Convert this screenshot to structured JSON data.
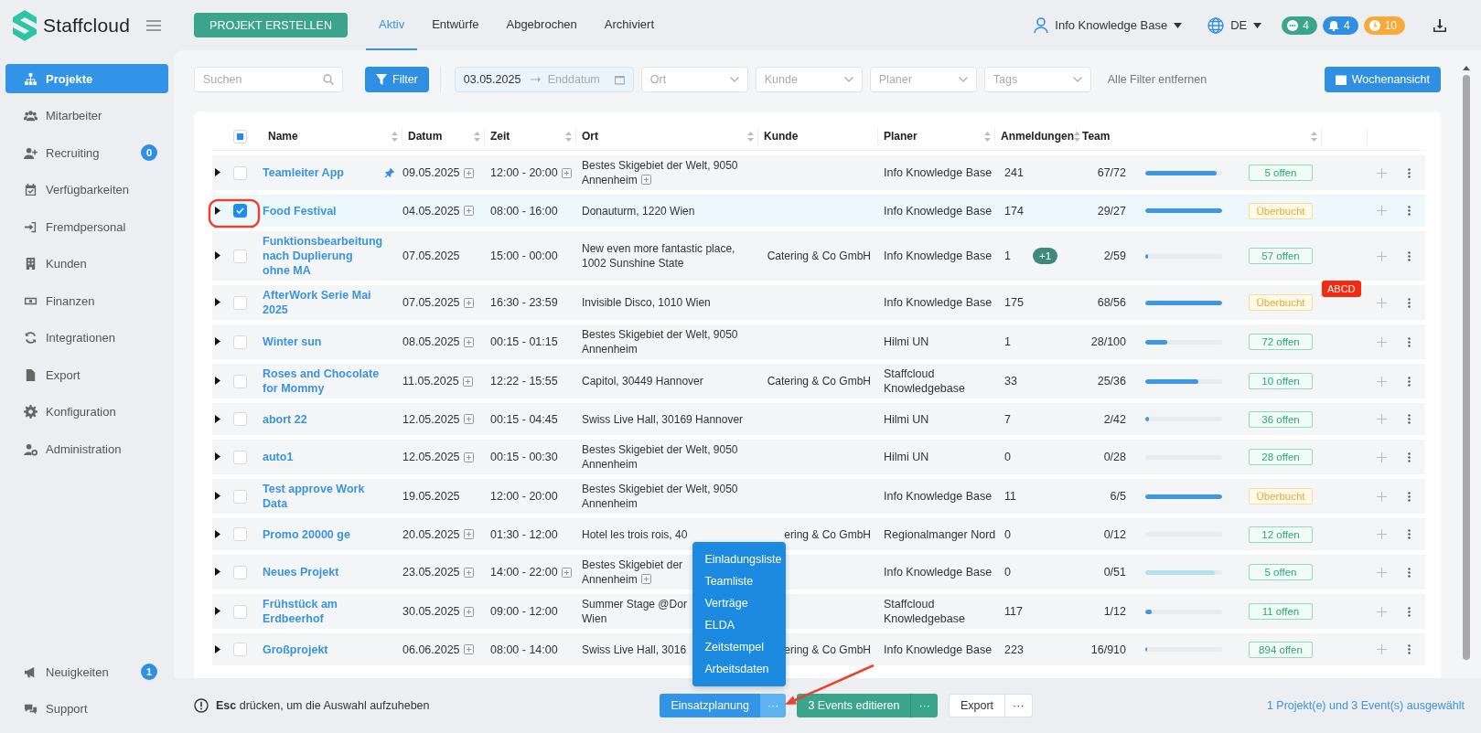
{
  "sidebar": {
    "brand": "Staffcloud",
    "items": [
      {
        "label": "Projekte",
        "selected": true
      },
      {
        "label": "Mitarbeiter",
        "selected": false
      },
      {
        "label": "Recruiting",
        "selected": false,
        "badge": "0"
      },
      {
        "label": "Verfügbarkeiten",
        "selected": false
      },
      {
        "label": "Fremdpersonal",
        "selected": false
      },
      {
        "label": "Kunden",
        "selected": false
      },
      {
        "label": "Finanzen",
        "selected": false
      },
      {
        "label": "Integrationen",
        "selected": false
      },
      {
        "label": "Export",
        "selected": false
      },
      {
        "label": "Konfiguration",
        "selected": false
      },
      {
        "label": "Administration",
        "selected": false
      }
    ],
    "footer_items": [
      {
        "label": "Neuigkeiten",
        "selected": false,
        "badge": "1"
      },
      {
        "label": "Support",
        "selected": false
      }
    ]
  },
  "topbar": {
    "create_button": "PROJEKT ERSTELLEN",
    "tabs": [
      {
        "label": "Aktiv",
        "selected": true
      },
      {
        "label": "Entwürfe",
        "selected": false
      },
      {
        "label": "Abgebrochen",
        "selected": false
      },
      {
        "label": "Archiviert",
        "selected": false
      }
    ],
    "user": "Info Knowledge Base",
    "language": "DE",
    "counters": [
      {
        "value": "4",
        "color": "#3aa58a"
      },
      {
        "value": "4",
        "color": "#2f8fe2"
      },
      {
        "value": "10",
        "color": "#f8a93a"
      }
    ]
  },
  "filters": {
    "search": {
      "placeholder": "Suchen"
    },
    "filter_button": "Filter",
    "date_range": {
      "start": "03.05.2025",
      "end_placeholder": "Enddatum"
    },
    "selects": [
      {
        "placeholder": "Ort"
      },
      {
        "placeholder": "Kunde"
      },
      {
        "placeholder": "Planer"
      },
      {
        "placeholder": "Tags"
      }
    ],
    "clear_link": "Alle Filter entfernen",
    "week_button": "Wochenansicht"
  },
  "table": {
    "select_all": {
      "partial": true
    },
    "columns": [
      "Name",
      "Datum",
      "Zeit",
      "Ort",
      "Kunde",
      "Planer",
      "Anmeldungen",
      "Team"
    ],
    "rows": [
      {
        "name": "Teamleiter App",
        "pinned": true,
        "date": "09.05.2025",
        "date_more": true,
        "time": "12:00 - 20:00",
        "time_more": true,
        "place": "Bestes Skigebiet der Welt, 9050\nAnnenheim",
        "place_more": true,
        "planner": "Info Knowledge Base",
        "registrations": "241",
        "team": "67/72",
        "level": 0.93,
        "status": {
          "label": "5 offen",
          "kind": "open"
        },
        "selected": false
      },
      {
        "name": "Food Festival",
        "pinned": false,
        "date": "04.05.2025",
        "date_more": true,
        "time": "08:00 - 16:00",
        "time_more": false,
        "place": "Donauturm, 1220 Wien",
        "place_more": false,
        "planner": "Info Knowledge Base",
        "registrations": "174",
        "team": "29/27",
        "level": 1,
        "status": {
          "label": "Überbucht",
          "kind": "overbooked"
        },
        "selected": true
      },
      {
        "name": "Funktionsbearbeitung\nnach Duplierung\nohne MA",
        "pinned": false,
        "date": "07.05.2025",
        "date_more": false,
        "time": "15:00 - 00:00",
        "time_more": false,
        "place": "New even more fantastic place,\n1002 Sunshine State",
        "place_more": false,
        "customer": "Catering & Co GmbH",
        "planner": "Info Knowledge Base",
        "registrations": "1",
        "registrations_extra": "+1",
        "team": "2/59",
        "level": 0.03,
        "status": {
          "label": "57 offen",
          "kind": "open"
        },
        "selected": false
      },
      {
        "name": "AfterWork Serie Mai\n2025",
        "pinned": false,
        "date": "07.05.2025",
        "date_more": true,
        "time": "16:30 - 23:59",
        "time_more": false,
        "place": "Invisible Disco, 1010 Wien",
        "place_more": false,
        "planner": "Info Knowledge Base",
        "registrations": "175",
        "team": "68/56",
        "level": 1,
        "status": {
          "label": "Überbucht",
          "kind": "overbooked"
        },
        "tag": "ABCD",
        "selected": false
      },
      {
        "name": "Winter sun",
        "pinned": false,
        "date": "08.05.2025",
        "date_more": true,
        "time": "00:15 - 01:15",
        "time_more": false,
        "place": "Bestes Skigebiet der Welt, 9050\nAnnenheim",
        "place_more": false,
        "planner": "Hilmi UN",
        "registrations": "1",
        "team": "28/100",
        "level": 0.28,
        "status": {
          "label": "72 offen",
          "kind": "open"
        },
        "selected": false
      },
      {
        "name": "Roses and Chocolate\nfor Mommy",
        "pinned": false,
        "date": "11.05.2025",
        "date_more": true,
        "time": "12:22 - 15:55",
        "time_more": false,
        "place": "Capitol, 30449 Hannover",
        "place_more": false,
        "customer": "Catering & Co GmbH",
        "planner": "Staffcloud\nKnowledgebase",
        "registrations": "33",
        "team": "25/36",
        "level": 0.69,
        "status": {
          "label": "10 offen",
          "kind": "open"
        },
        "selected": false
      },
      {
        "name": "abort 22",
        "pinned": false,
        "date": "12.05.2025",
        "date_more": true,
        "time": "00:15 - 04:45",
        "time_more": false,
        "place": "Swiss Live Hall, 30169 Hannover",
        "place_more": false,
        "planner": "Hilmi UN",
        "registrations": "7",
        "team": "2/42",
        "level": 0.05,
        "status": {
          "label": "36 offen",
          "kind": "open"
        },
        "selected": false
      },
      {
        "name": "auto1",
        "pinned": false,
        "date": "12.05.2025",
        "date_more": true,
        "time": "00:15 - 00:30",
        "time_more": false,
        "place": "Bestes Skigebiet der Welt, 9050\nAnnenheim",
        "place_more": false,
        "planner": "Hilmi UN",
        "registrations": "0",
        "team": "0/28",
        "level": 0,
        "status": {
          "label": "28 offen",
          "kind": "open"
        },
        "selected": false
      },
      {
        "name": "Test approve Work\nData",
        "pinned": false,
        "date": "19.05.2025",
        "date_more": false,
        "time": "12:00 - 20:00",
        "time_more": false,
        "place": "Bestes Skigebiet der Welt, 9050\nAnnenheim",
        "place_more": false,
        "planner": "Info Knowledge Base",
        "registrations": "11",
        "team": "6/5",
        "level": 1,
        "status": {
          "label": "Überbucht",
          "kind": "overbooked"
        },
        "selected": false
      },
      {
        "name": "Promo 20000 ge",
        "pinned": false,
        "date": "20.05.2025",
        "date_more": true,
        "time": "01:30 - 12:00",
        "time_more": false,
        "place": "Hotel les trois rois, 40",
        "place_more": false,
        "customer": "ering & Co GmbH",
        "planner": "Regionalmanger Nord",
        "registrations": "0",
        "team": "0/12",
        "level": 0,
        "status": {
          "label": "12 offen",
          "kind": "open"
        },
        "selected": false
      },
      {
        "name": "Neues Projekt",
        "pinned": false,
        "date": "23.05.2025",
        "date_more": true,
        "time": "14:00 - 22:00",
        "time_more": true,
        "place": "Bestes Skigebiet der\nAnnenheim",
        "place_more": true,
        "planner": "Info Knowledge Base",
        "registrations": "0",
        "team": "0/51",
        "level": 0.9,
        "light": true,
        "status": {
          "label": "5 offen",
          "kind": "open"
        },
        "selected": false
      },
      {
        "name": "Frühstück am\nErdbeerhof",
        "pinned": false,
        "date": "30.05.2025",
        "date_more": true,
        "time": "09:00 - 12:00",
        "time_more": false,
        "place": "Summer Stage @Dor\nWien",
        "place_more": false,
        "planner": "Staffcloud\nKnowledgebase",
        "registrations": "117",
        "team": "1/12",
        "level": 0.08,
        "status": {
          "label": "11 offen",
          "kind": "open"
        },
        "selected": false
      },
      {
        "name": "Großprojekt",
        "pinned": false,
        "date": "06.06.2025",
        "date_more": true,
        "time": "08:00 - 14:00",
        "time_more": false,
        "place": "Swiss Live Hall, 3016",
        "place_more": false,
        "customer": "ering & Co GmbH",
        "planner": "Info Knowledge Base",
        "registrations": "223",
        "team": "16/910",
        "level": 0.02,
        "status": {
          "label": "894 offen",
          "kind": "open"
        },
        "selected": false
      }
    ]
  },
  "bottom_bar": {
    "hint": "**Esc** drücken, um die Auswahl aufzuheben",
    "actions": [
      {
        "label": "Einsatzplanung",
        "more": "···",
        "kind": "primary",
        "menu": [
          "Einladungsliste",
          "Teamliste",
          "Verträge",
          "ELDA",
          "Zeitstempel",
          "Arbeitsdaten"
        ]
      },
      {
        "label": "3 Events editieren",
        "more": "···",
        "kind": "success"
      },
      {
        "label": "Export",
        "more": "···",
        "kind": "plain"
      }
    ],
    "selection_info": "1 Projekt(e) und 3 Event(s) ausgewählt"
  }
}
